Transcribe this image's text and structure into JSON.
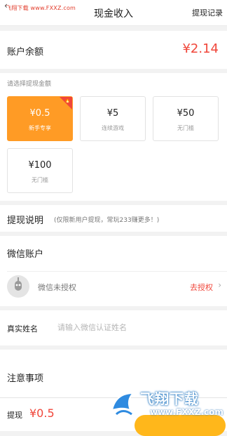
{
  "watermark_top": "飞翔下载 www.FXXZ.com",
  "header": {
    "title": "现金收入",
    "record_label": "提现记录"
  },
  "balance": {
    "label": "账户余额",
    "value": "¥2.14"
  },
  "amounts": {
    "hint": "请选择提现金额",
    "options": [
      {
        "amount": "¥0.5",
        "sub": "新手专享",
        "selected": true
      },
      {
        "amount": "¥5",
        "sub": "连续游戏",
        "selected": false
      },
      {
        "amount": "¥50",
        "sub": "无门槛",
        "selected": false
      },
      {
        "amount": "¥100",
        "sub": "无门槛",
        "selected": false
      }
    ]
  },
  "explain": {
    "label": "提现说明",
    "note": "(仅限新用户提现，常玩233赚更多！)"
  },
  "wechat": {
    "title": "微信账户",
    "status": "微信未授权",
    "authorize": "去授权"
  },
  "real_name": {
    "label": "真实姓名",
    "placeholder": "请输入微信认证姓名"
  },
  "notes": {
    "title": "注意事项"
  },
  "bottom": {
    "label": "提现",
    "amount": "¥0.5"
  },
  "watermark_badge": {
    "text": "飞翔下载",
    "url": "www.FXXZ.com"
  },
  "colors": {
    "accent": "#f0463a",
    "selected": "#ff9b25",
    "button": "#ffb71b"
  },
  "icons": [
    "back-icon",
    "fire-icon",
    "avatar-icon",
    "chevron-right-icon"
  ]
}
